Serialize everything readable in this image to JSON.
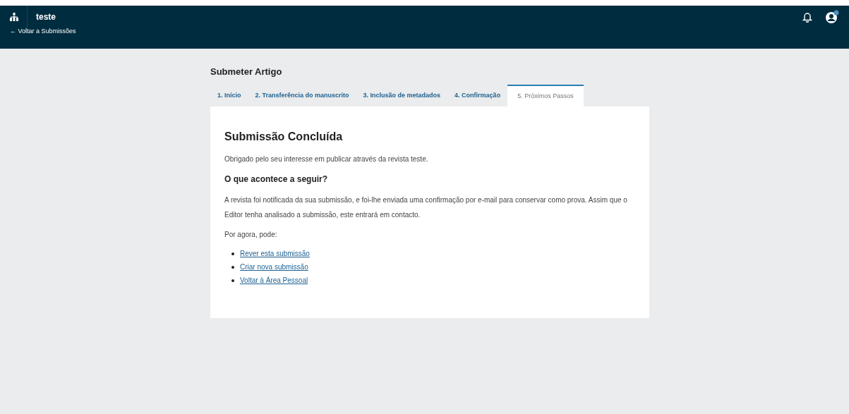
{
  "header": {
    "site": "teste",
    "back_link": "← Voltar a Submissões"
  },
  "page_title": "Submeter Artigo",
  "tabs": [
    {
      "label": "1. Início",
      "selected": false
    },
    {
      "label": "2. Transferência do manuscrito",
      "selected": false
    },
    {
      "label": "3. Inclusão de metadados",
      "selected": false
    },
    {
      "label": "4. Confirmação",
      "selected": false
    },
    {
      "label": "5. Próximos Passos",
      "selected": true
    }
  ],
  "panel": {
    "heading": "Submissão Concluída",
    "thanks": "Obrigado pelo seu interesse em publicar através da revista teste.",
    "subheading": "O que acontece a seguir?",
    "body": "A revista foi notificada da sua submissão, e foi-lhe enviada uma confirmação por e-mail para conservar como prova. Assim que o Editor tenha analisado a submissão, este entrará em contacto.",
    "prompt": "Por agora, pode:",
    "links": [
      "Rever esta submissão",
      "Criar nova submissão",
      "Voltar à Área Pessoal"
    ]
  }
}
